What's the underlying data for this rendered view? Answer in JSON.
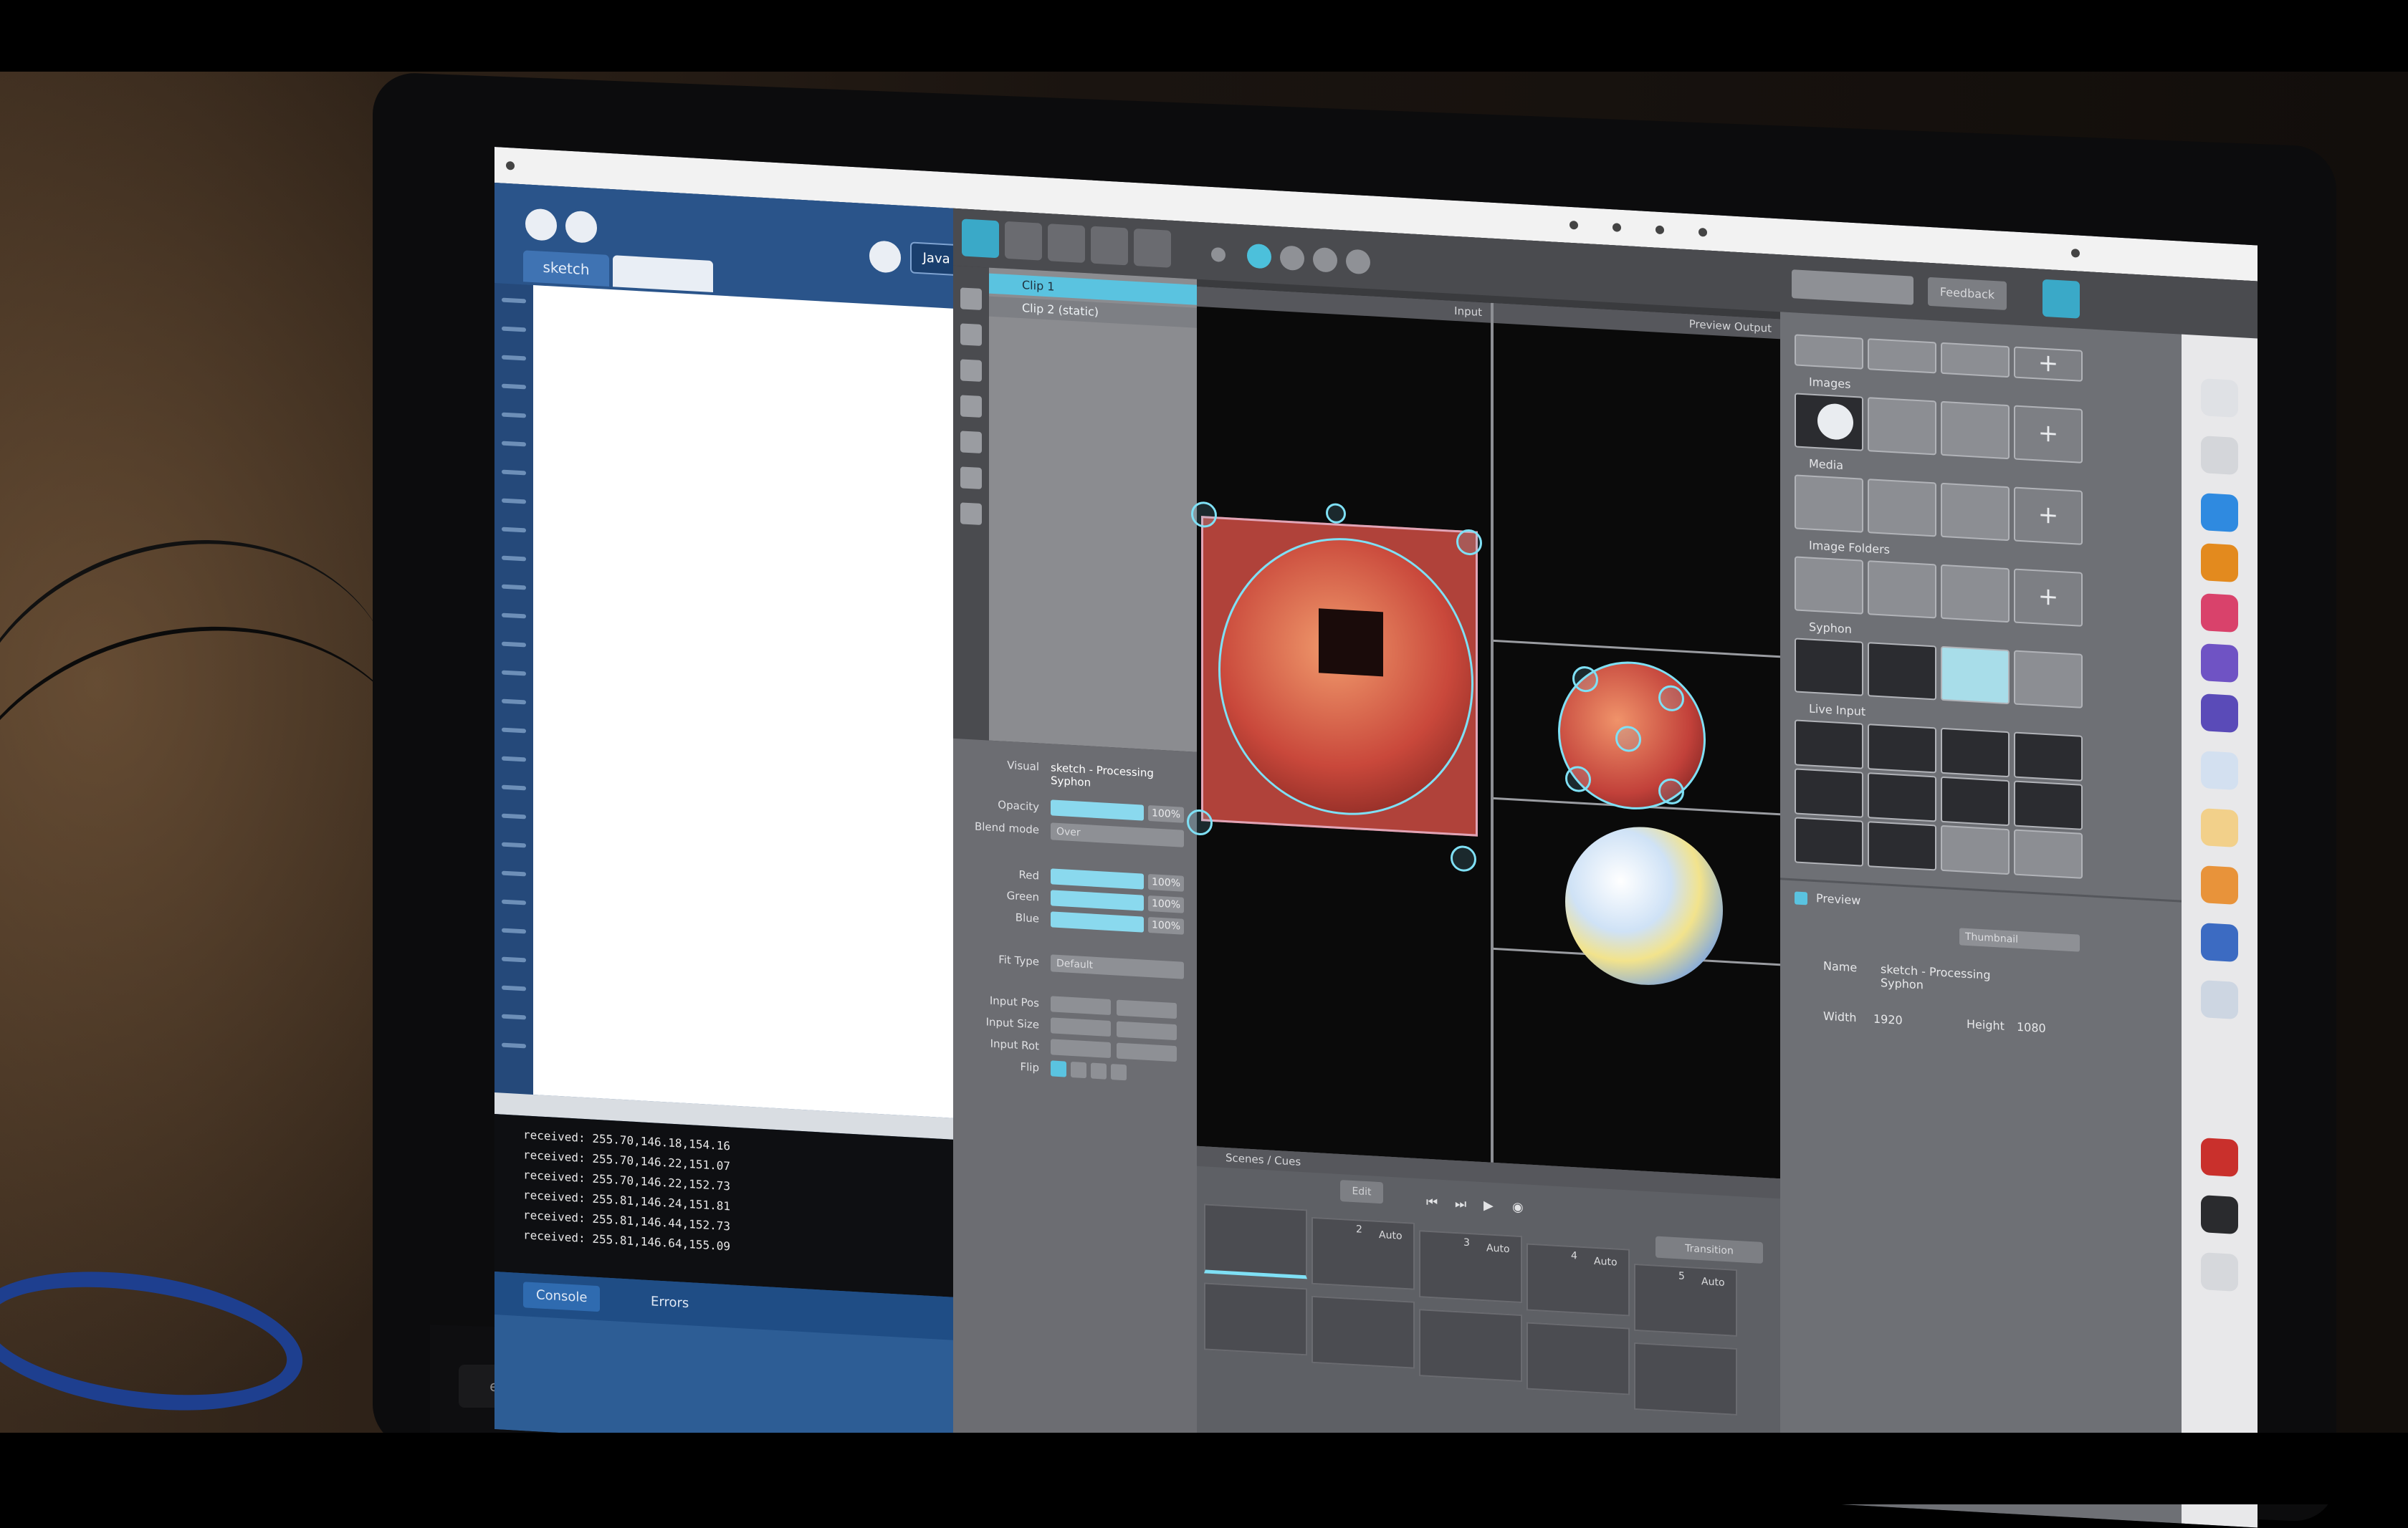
{
  "editor": {
    "tab_label": "sketch",
    "mode_button": "Java ▾",
    "console_lines": [
      "received: 255.70,146.18,154.16",
      "received: 255.70,146.22,151.07",
      "received: 255.70,146.22,152.73",
      "received: 255.81,146.24,151.81",
      "received: 255.81,146.44,152.73",
      "received: 255.81,146.64,155.09"
    ],
    "console_tab": "Console",
    "errors_tab": "Errors"
  },
  "app": {
    "layers": {
      "row1": "Clip 1",
      "row2": "Clip 2 (static)"
    },
    "props": {
      "title_label": "Visual",
      "title_value": "sketch - Processing Syphon",
      "opacity_label": "Opacity",
      "opacity_value": "100%",
      "blend_label": "Blend mode",
      "blend_value": "Over",
      "red_label": "Red",
      "red_value": "100%",
      "green_label": "Green",
      "green_value": "100%",
      "blue_label": "Blue",
      "blue_value": "100%",
      "fit_label": "Fit Type",
      "fit_value": "Default",
      "inpos_label": "Input Pos",
      "insize_label": "Input Size",
      "inrot_label": "Input Rot",
      "flip_label": "Flip"
    },
    "input_label": "Input",
    "output_label": "Preview Output",
    "feedback_button": "Feedback",
    "timeline": {
      "header": "Scenes / Cues",
      "edit_button": "Edit",
      "cue_nums": [
        "2",
        "3",
        "4",
        "5"
      ],
      "cue_mode": "Auto",
      "transition_button": "Transition"
    },
    "right": {
      "images_label": "Images",
      "media_label": "Media",
      "image_folders_label": "Image Folders",
      "syphon_label": "Syphon",
      "live_input_label": "Live Input",
      "preview_label": "Preview",
      "preview_mode": "Thumbnail",
      "name_label": "Name",
      "name_value": "sketch - Processing Syphon",
      "width_label": "Width",
      "width_value": "1920",
      "height_label": "Height",
      "height_value": "1080",
      "plus_symbol": "+"
    }
  },
  "keyboard": {
    "esc": "esc"
  }
}
